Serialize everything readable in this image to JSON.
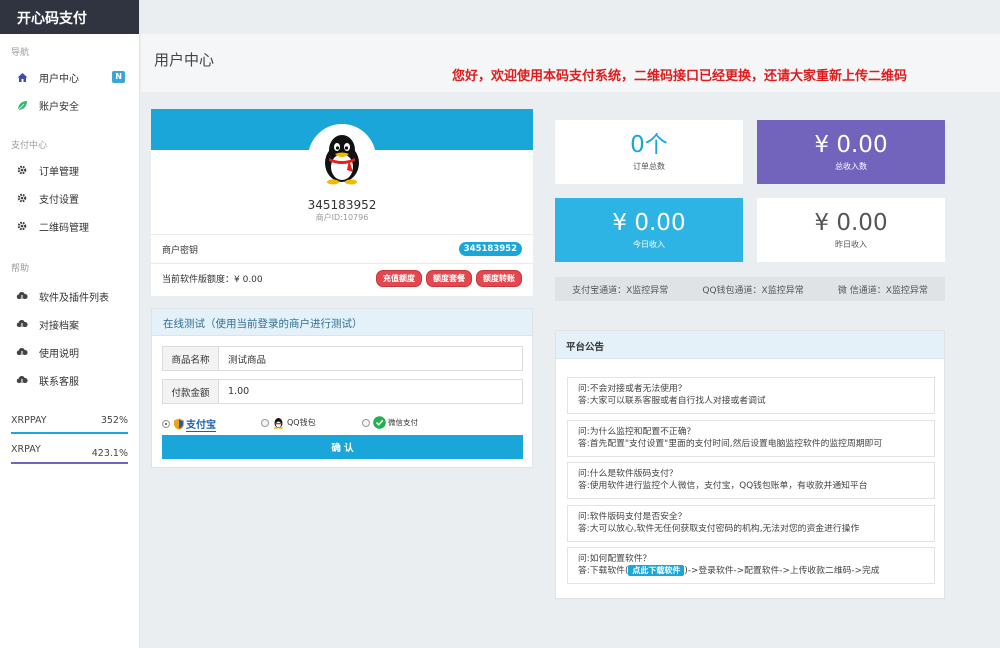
{
  "app": {
    "title": "开心码支付"
  },
  "sidebar": {
    "sections": [
      {
        "label": "导航"
      },
      {
        "label": "支付中心"
      },
      {
        "label": "帮助"
      }
    ],
    "items": [
      {
        "label": "用户中心",
        "icon": "home-icon",
        "badge": "N"
      },
      {
        "label": "账户安全",
        "icon": "leaf-icon"
      },
      {
        "label": "订单管理",
        "icon": "gear-icon"
      },
      {
        "label": "支付设置",
        "icon": "gear-icon"
      },
      {
        "label": "二维码管理",
        "icon": "gear-icon"
      },
      {
        "label": "软件及插件列表",
        "icon": "cloud-download-icon"
      },
      {
        "label": "对接档案",
        "icon": "cloud-download-icon"
      },
      {
        "label": "使用说明",
        "icon": "cloud-download-icon"
      },
      {
        "label": "联系客服",
        "icon": "cloud-download-icon"
      }
    ],
    "progress": [
      {
        "name": "XRPPAY",
        "value": "352%",
        "color": "#1aa6d8"
      },
      {
        "name": "XRPAY",
        "value": "423.1%",
        "color": "#7264bd"
      }
    ]
  },
  "header": {
    "title": "用户中心",
    "notice": "您好，欢迎使用本码支付系统，二维码接口已经更换，还请大家重新上传二维码"
  },
  "profile": {
    "uid": "345183952",
    "merchant_id": "商户ID:10796",
    "key_label": "商户密钥",
    "key_value": "345183952",
    "quota_label": "当前软件版额度：¥ 0.00",
    "buttons": [
      "充值额度",
      "额度套餐",
      "额度转账"
    ]
  },
  "test": {
    "title": "在线测试（使用当前登录的商户进行测试）",
    "product_label": "商品名称",
    "product_value": "测试商品",
    "amount_label": "付款金额",
    "amount_value": "1.00",
    "pay_options": [
      "支付宝",
      "QQ钱包",
      "微信支付"
    ],
    "selected": "支付宝",
    "confirm_label": "确 认"
  },
  "stats": [
    {
      "value": "0个",
      "label": "订单总数",
      "color": "#1aa6d8"
    },
    {
      "value": "¥ 0.00",
      "label": "总收入数",
      "color": "#7264bd"
    },
    {
      "value": "¥ 0.00",
      "label": "今日收入",
      "color": "#2eb3e5"
    },
    {
      "value": "¥ 0.00",
      "label": "昨日收入",
      "color": "#555555"
    }
  ],
  "channels": [
    "支付宝通道：X监控异常",
    "QQ钱包通道：X监控异常",
    "微 信通道：X监控异常"
  ],
  "announcements": {
    "title": "平台公告",
    "items": [
      {
        "q": "问:不会对接或者无法使用？",
        "a": "答:大家可以联系客服或者自行找人对接或者调试"
      },
      {
        "q": "问:为什么监控和配置不正确？",
        "a": "答:首先配置\"支付设置\"里面的支付时间,然后设置电脑监控软件的监控周期即可"
      },
      {
        "q": "问:什么是软件版码支付？",
        "a": "答:使用软件进行监控个人微信，支付宝，QQ钱包账单，有收款并通知平台"
      },
      {
        "q": "问:软件版码支付是否安全？",
        "a": "答:大可以放心,软件无任何获取支付密码的机构,无法对您的资金进行操作"
      },
      {
        "q": "问:如何配置软件？",
        "a_prefix": "答:下载软件(",
        "download_label": "点此下载软件",
        "a_suffix": ")->登录软件->配置软件->上传收款二维码->完成"
      }
    ]
  }
}
